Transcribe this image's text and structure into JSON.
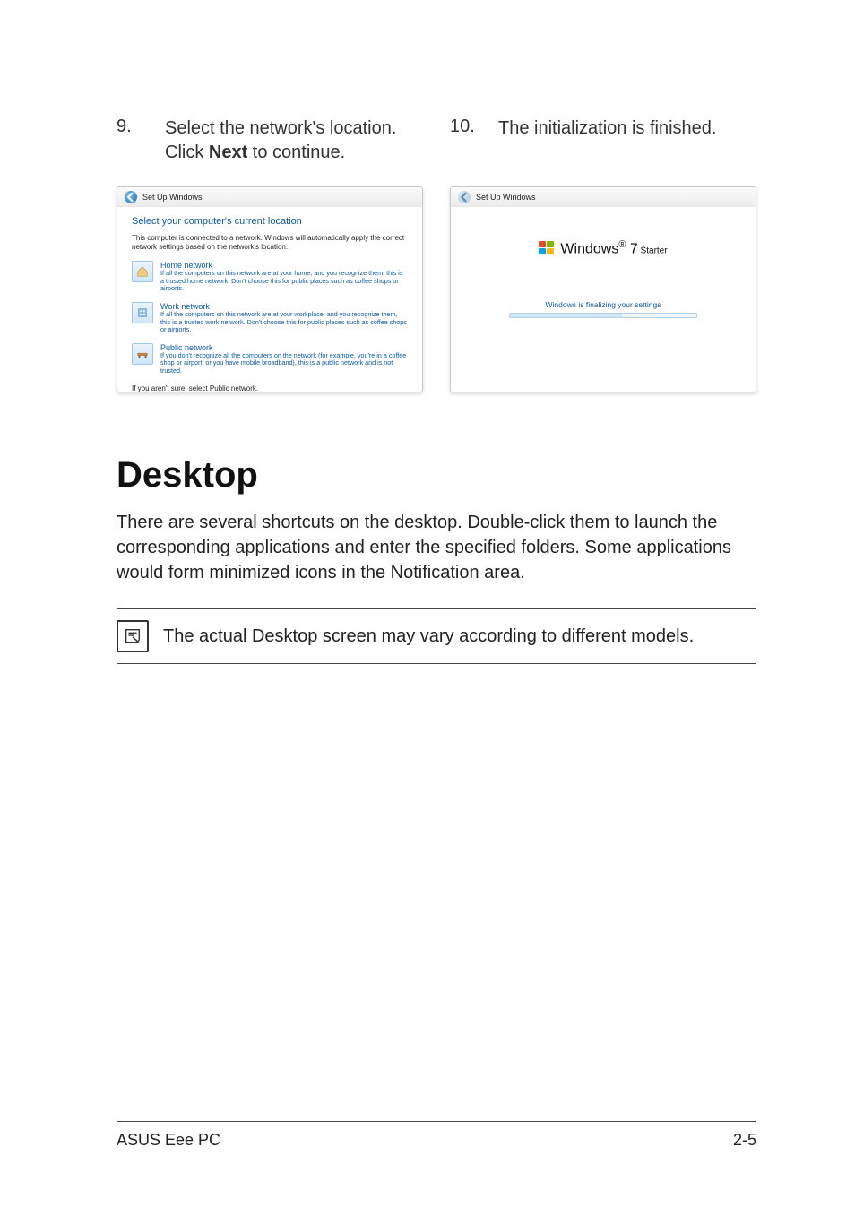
{
  "steps": {
    "s9": {
      "num": "9.",
      "text_a": "Select the network's location. Click ",
      "bold": "Next",
      "text_b": " to continue."
    },
    "s10": {
      "num": "10.",
      "text": "The initialization is finished."
    }
  },
  "shot1": {
    "window_title": "Set Up Windows",
    "heading": "Select your computer's current location",
    "note": "This computer is connected to a network. Windows will automatically apply the correct network settings based on the network's location.",
    "opts": [
      {
        "title": "Home network",
        "desc": "If all the computers on this network are at your home, and you recognize them, this is a trusted home network. Don't choose this for public places such as coffee shops or airports."
      },
      {
        "title": "Work network",
        "desc": "If all the computers on this network are at your workplace, and you recognize them, this is a trusted work network. Don't choose this for public places such as coffee shops or airports."
      },
      {
        "title": "Public network",
        "desc": "If you don't recognize all the computers on the network (for example, you're in a coffee shop or airport, or you have mobile broadband), this is a public network and is not trusted."
      }
    ],
    "footer_note": "If you aren't sure, select Public network."
  },
  "shot2": {
    "window_title": "Set Up Windows",
    "brand_a": "Windows",
    "brand_b": "7",
    "brand_c": " Starter",
    "status": "Windows is finalizing your settings"
  },
  "desktop": {
    "heading": "Desktop",
    "para": "There are several shortcuts on the desktop. Double-click them to launch the corresponding applications and enter the specified folders. Some applications would form minimized icons in the Notification area.",
    "callout": "The actual Desktop screen may vary according to different models."
  },
  "footer": {
    "left": "ASUS Eee PC",
    "right": "2-5"
  }
}
